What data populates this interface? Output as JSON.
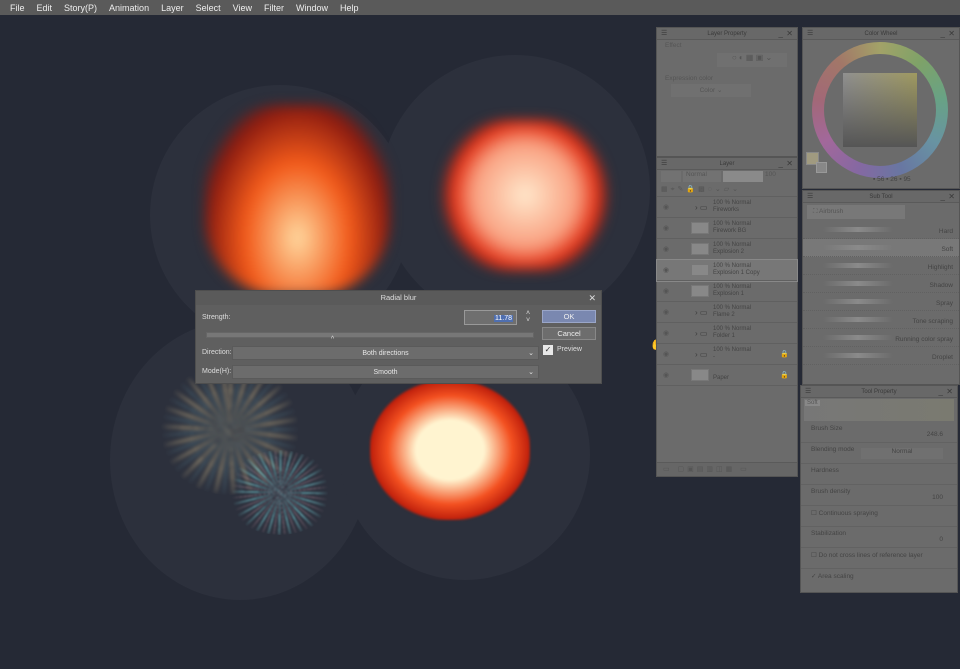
{
  "menu": [
    "File",
    "Edit",
    "Story(P)",
    "Animation",
    "Layer",
    "Select",
    "View",
    "Filter",
    "Window",
    "Help"
  ],
  "dialog": {
    "title": "Radial blur",
    "strength_label": "Strength:",
    "strength_value": "11.78",
    "direction_label": "Direction:",
    "direction_value": "Both directions",
    "mode_label": "Mode(H):",
    "mode_value": "Smooth",
    "ok": "OK",
    "cancel": "Cancel",
    "preview": "Preview",
    "preview_checked": true,
    "slider_fraction": 0.39
  },
  "layer_property": {
    "title": "Layer Property",
    "effect": "Effect",
    "expression_color": "Expression color",
    "color": "Color"
  },
  "color_wheel": {
    "title": "Color Wheel",
    "h": "56",
    "s": "26",
    "v": "95"
  },
  "layer": {
    "title": "Layer",
    "blend": "Normal",
    "opacity": "100",
    "rows": [
      {
        "mode": "100 % Normal",
        "name": "Fireworks",
        "type": "folder"
      },
      {
        "mode": "100 % Normal",
        "name": "Firework BG",
        "type": "raster"
      },
      {
        "mode": "100 % Normal",
        "name": "Explosion 2",
        "type": "raster"
      },
      {
        "mode": "100 % Normal",
        "name": "Explosion 1 Copy",
        "type": "raster",
        "selected": true
      },
      {
        "mode": "100 % Normal",
        "name": "Explosion 1",
        "type": "raster"
      },
      {
        "mode": "100 % Normal",
        "name": "Flame 2",
        "type": "folder"
      },
      {
        "mode": "100 % Normal",
        "name": "Folder 1",
        "type": "folder"
      },
      {
        "mode": "100 % Normal",
        "name": "-",
        "type": "folder",
        "locked": true
      },
      {
        "mode": "",
        "name": "Paper",
        "type": "paper",
        "locked": true
      }
    ]
  },
  "sub_tool": {
    "title": "Sub Tool",
    "group": "Airbrush",
    "items": [
      "Hard",
      "Soft",
      "Highlight",
      "Shadow",
      "Spray",
      "Tone scraping",
      "Running color spray",
      "Droplet"
    ],
    "selected": "Soft"
  },
  "tool_property": {
    "title": "Tool Property",
    "preset": "Soft",
    "brush_size_label": "Brush Size",
    "brush_size": "248.6",
    "blending_label": "Blending mode",
    "blending": "Normal",
    "hardness_label": "Hardness",
    "density_label": "Brush density",
    "density": "100",
    "continuous": "Continuous spraying",
    "stabilization_label": "Stabilization",
    "stabilization": "0",
    "no_cross": "Do not cross lines of reference layer",
    "area_scaling": "Area scaling"
  }
}
